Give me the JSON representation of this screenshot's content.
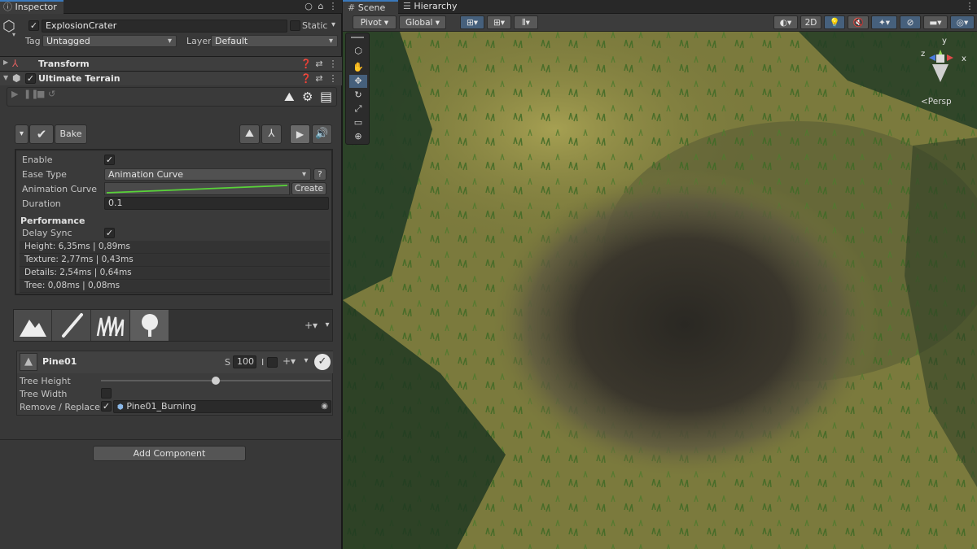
{
  "inspector": {
    "tab_label": "Inspector",
    "object_name": "ExplosionCrater",
    "static_label": "Static",
    "tag_label": "Tag",
    "tag_value": "Untagged",
    "layer_label": "Layer",
    "layer_value": "Default",
    "components": [
      {
        "name": "Transform"
      },
      {
        "name": "Ultimate Terrain"
      }
    ],
    "bake_label": "Bake",
    "settings": {
      "enable_label": "Enable",
      "ease_type_label": "Ease Type",
      "ease_type_value": "Animation Curve",
      "help_label": "?",
      "anim_curve_label": "Animation Curve",
      "create_label": "Create",
      "duration_label": "Duration",
      "duration_value": "0.1",
      "performance_label": "Performance",
      "delay_sync_label": "Delay Sync",
      "stats": [
        "Height: 6,35ms | 0,89ms",
        "Texture: 2,77ms | 0,43ms",
        "Details: 2,54ms | 0,64ms",
        "Tree: 0,08ms | 0,08ms"
      ]
    },
    "tool_tabs": [
      "terrain-raise-icon",
      "paint-brush-icon",
      "grass-icon",
      "tree-icon"
    ],
    "tree": {
      "name": "Pine01",
      "s_label": "S",
      "s_value": "100",
      "i_label": "I",
      "height_label": "Tree Height",
      "width_label": "Tree Width",
      "replace_label": "Remove / Replace",
      "replace_value": "Pine01_Burning",
      "height_slider": 0.51
    },
    "add_component_label": "Add Component"
  },
  "scene": {
    "tabs": [
      "Scene",
      "Hierarchy"
    ],
    "pivot_label": "Pivot",
    "global_label": "Global",
    "mode_2d": "2D",
    "persp_label": "<Persp",
    "gizmo_axes": [
      "y",
      "x",
      "z"
    ]
  },
  "colors": {
    "accent": "#3a79bb",
    "panel": "#383838",
    "curve": "#59d339",
    "grass": "#8a8a44"
  }
}
